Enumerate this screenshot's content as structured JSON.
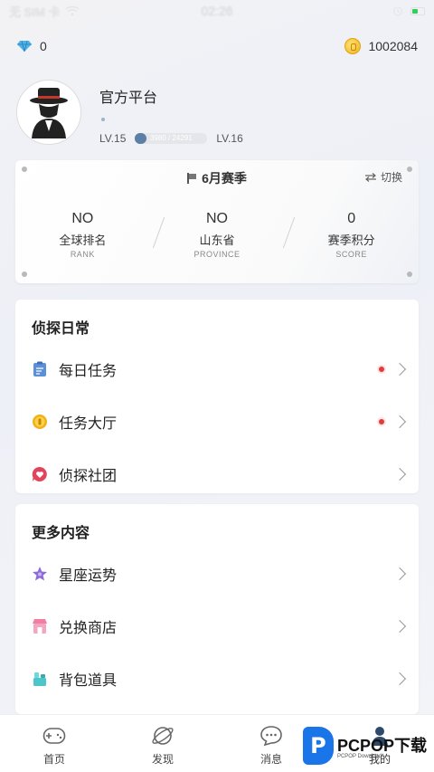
{
  "status_bar": {
    "carrier": "无 SIM 卡",
    "time": "02:26"
  },
  "topbar": {
    "diamonds": "0",
    "coins": "1002084"
  },
  "profile": {
    "name": "官方平台",
    "current_level": "LV.15",
    "next_level": "LV.16",
    "xp_text": "3980 / 24291",
    "xp_progress": 0.164
  },
  "season": {
    "title": "6月赛季",
    "switch_label": "切换",
    "stats": [
      {
        "value": "NO",
        "label": "全球排名",
        "sub": "RANK"
      },
      {
        "value": "NO",
        "label": "山东省",
        "sub": "PROVINCE"
      },
      {
        "value": "0",
        "label": "赛季积分",
        "sub": "SCORE"
      }
    ]
  },
  "detective_daily": {
    "title": "侦探日常",
    "items": [
      {
        "label": "每日任务",
        "icon": "clipboard-icon",
        "badge": true
      },
      {
        "label": "任务大厅",
        "icon": "coin-icon",
        "badge": true
      },
      {
        "label": "侦探社团",
        "icon": "heart-chat-icon",
        "badge": false
      }
    ]
  },
  "more_content": {
    "title": "更多内容",
    "items": [
      {
        "label": "星座运势",
        "icon": "star-icon"
      },
      {
        "label": "兑换商店",
        "icon": "shop-icon"
      },
      {
        "label": "背包道具",
        "icon": "backpack-icon"
      }
    ]
  },
  "tabs": [
    {
      "label": "首页",
      "icon": "game-icon"
    },
    {
      "label": "发现",
      "icon": "planet-icon"
    },
    {
      "label": "消息",
      "icon": "chat-icon"
    },
    {
      "label": "我的",
      "icon": "user-icon"
    }
  ],
  "watermark": {
    "brand": "PCPOP下载",
    "sub": "PCPOP Download"
  },
  "colors": {
    "accent": "#5c7fa5",
    "badge": "#e23b3b",
    "coin": "#f0b21a",
    "watermark": "#1a76e8"
  }
}
